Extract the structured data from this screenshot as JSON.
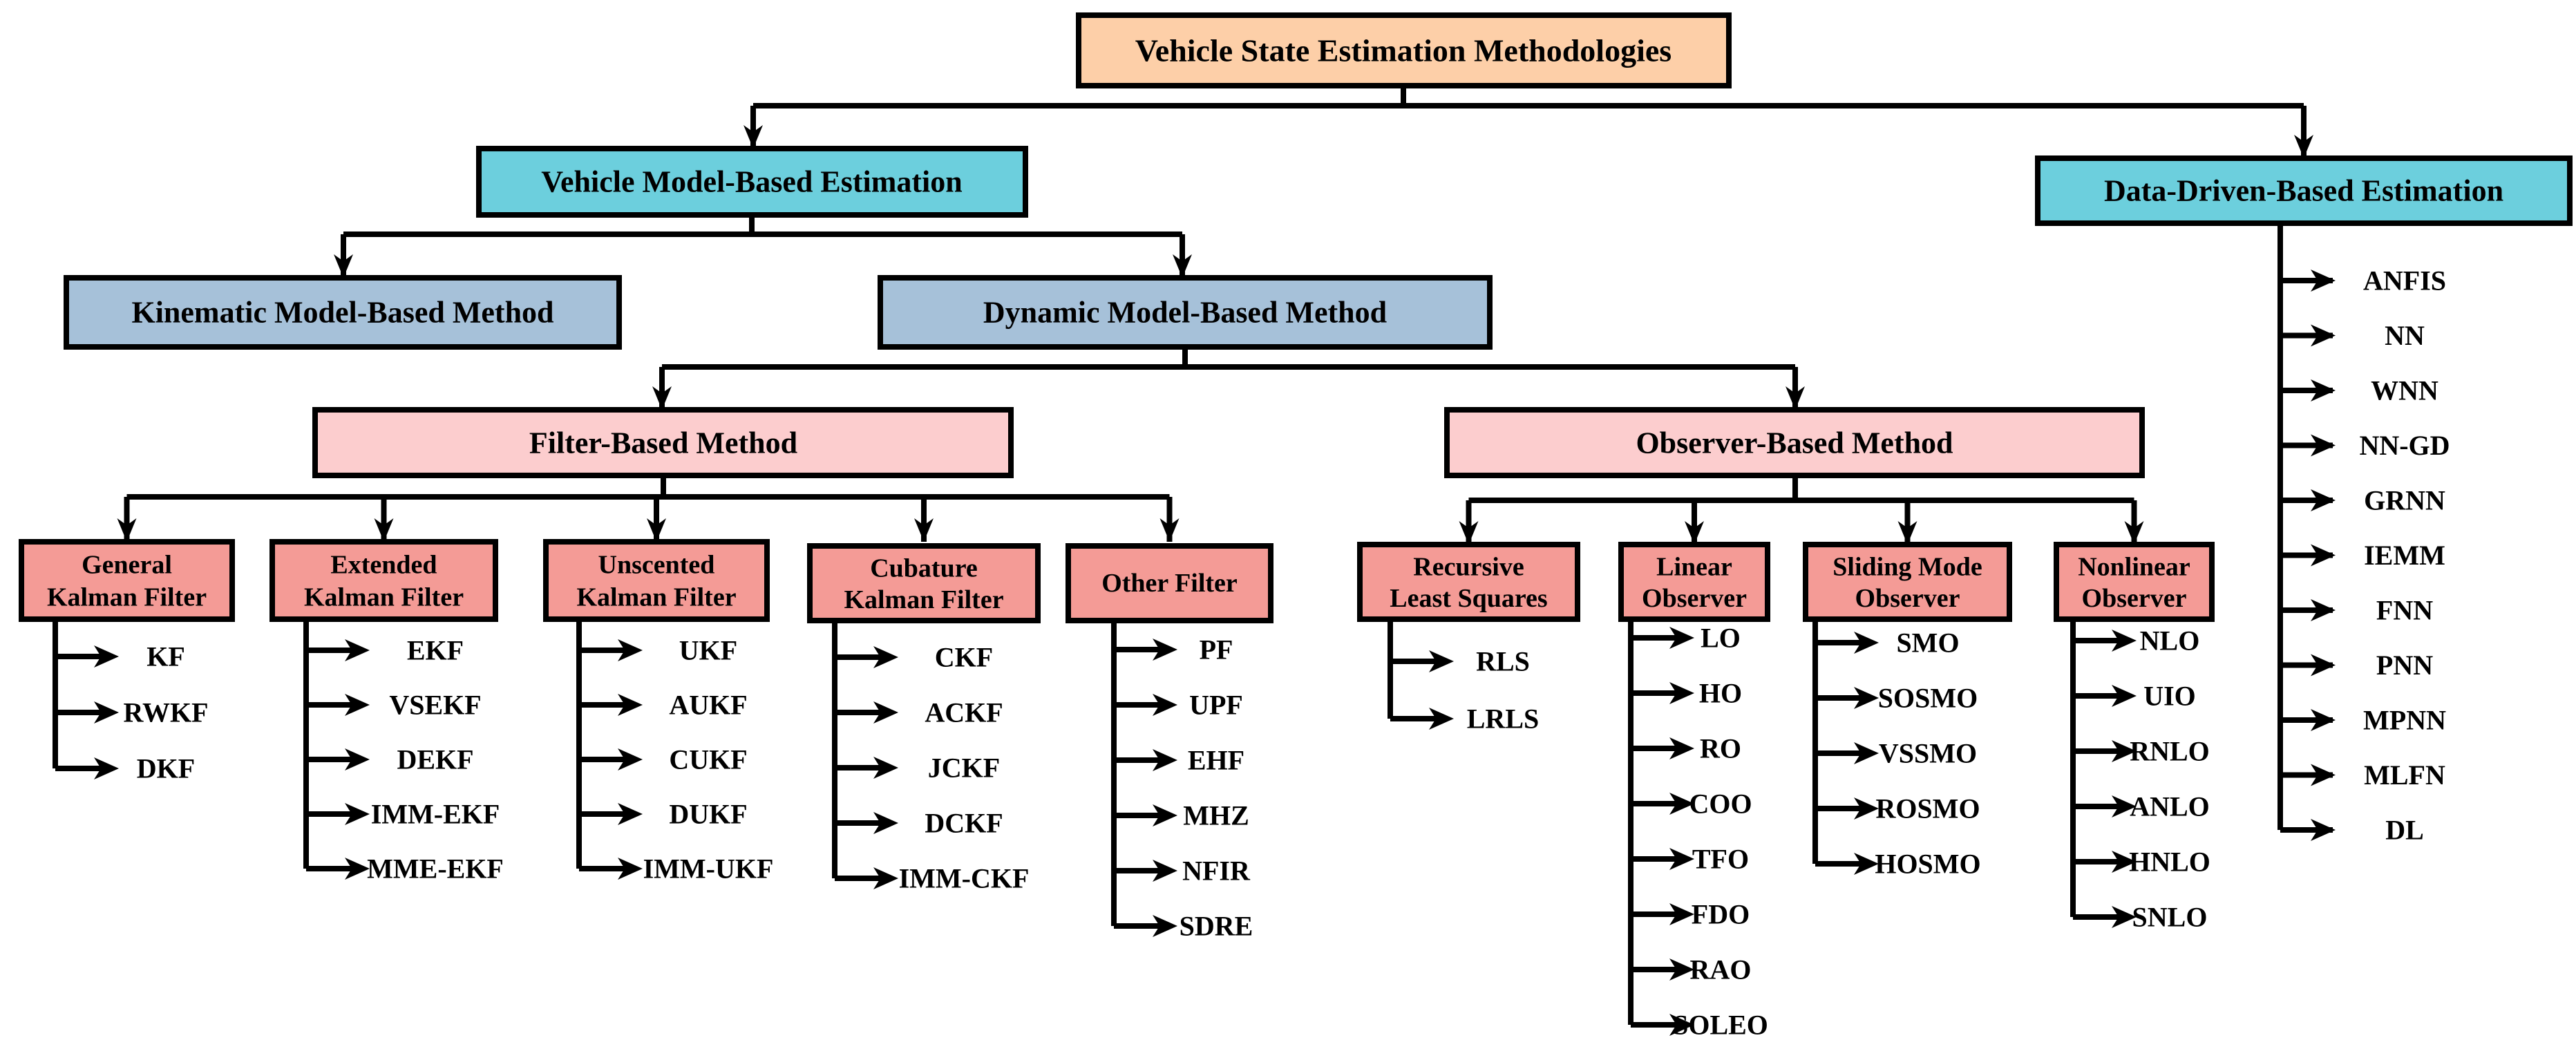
{
  "colors": {
    "root": "#fdcfa8",
    "level1": "#6ccfdd",
    "level2": "#a6c1d9",
    "level3": "#fccdce",
    "level4": "#f49b96",
    "line": "#000000"
  },
  "root": {
    "label": "Vehicle State Estimation Methodologies"
  },
  "vehicle_model": {
    "label": "Vehicle Model-Based Estimation"
  },
  "data_driven": {
    "label": "Data-Driven-Based Estimation",
    "items": [
      "ANFIS",
      "NN",
      "WNN",
      "NN-GD",
      "GRNN",
      "IEMM",
      "FNN",
      "PNN",
      "MPNN",
      "MLFN",
      "DL"
    ]
  },
  "kinematic": {
    "label": "Kinematic Model-Based Method"
  },
  "dynamic": {
    "label": "Dynamic Model-Based Method"
  },
  "filter_based": {
    "label": "Filter-Based Method"
  },
  "observer_based": {
    "label": "Observer-Based Method"
  },
  "filters": [
    {
      "label": [
        "General",
        "Kalman Filter"
      ],
      "items": [
        "KF",
        "RWKF",
        "DKF"
      ]
    },
    {
      "label": [
        "Extended",
        "Kalman Filter"
      ],
      "items": [
        "EKF",
        "VSEKF",
        "DEKF",
        "IMM-EKF",
        "MME-EKF"
      ]
    },
    {
      "label": [
        "Unscented",
        "Kalman Filter"
      ],
      "items": [
        "UKF",
        "AUKF",
        "CUKF",
        "DUKF",
        "IMM-UKF"
      ]
    },
    {
      "label": [
        "Cubature",
        "Kalman Filter"
      ],
      "items": [
        "CKF",
        "ACKF",
        "JCKF",
        "DCKF",
        "IMM-CKF"
      ]
    },
    {
      "label": [
        "Other Filter"
      ],
      "items": [
        "PF",
        "UPF",
        "EHF",
        "MHZ",
        "NFIR",
        "SDRE"
      ]
    }
  ],
  "observers": [
    {
      "label": [
        "Recursive",
        "Least Squares"
      ],
      "items": [
        "RLS",
        "LRLS"
      ]
    },
    {
      "label": [
        "Linear",
        "Observer"
      ],
      "items": [
        "LO",
        "HO",
        "RO",
        "COO",
        "TFO",
        "FDO",
        "RAO",
        "SOLEO"
      ]
    },
    {
      "label": [
        "Sliding Mode",
        "Observer"
      ],
      "items": [
        "SMO",
        "SOSMO",
        "VSSMO",
        "ROSMO",
        "HOSMO"
      ]
    },
    {
      "label": [
        "Nonlinear",
        "Observer"
      ],
      "items": [
        "NLO",
        "UIO",
        "RNLO",
        "ANLO",
        "HNLO",
        "SNLO"
      ]
    }
  ]
}
